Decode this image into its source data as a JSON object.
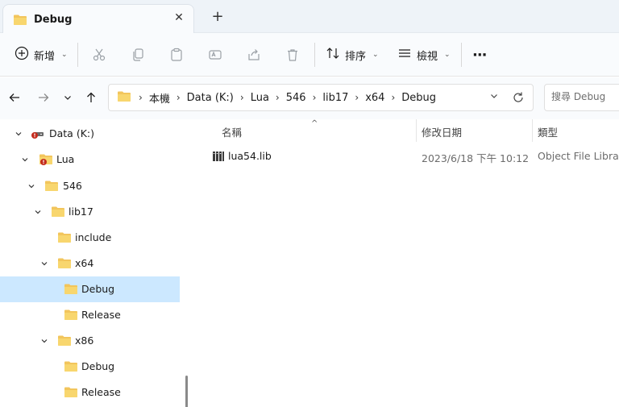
{
  "window": {
    "tab_title": "Debug",
    "close_glyph": "✕",
    "new_tab_glyph": "+"
  },
  "toolbar": {
    "new_label": "新增",
    "sort_label": "排序",
    "view_label": "檢視",
    "more_glyph": "···"
  },
  "address": {
    "crumbs": [
      "本機",
      "Data (K:)",
      "Lua",
      "546",
      "lib17",
      "x64",
      "Debug"
    ],
    "search_placeholder": "搜尋 Debug"
  },
  "nav_tree": [
    {
      "label": "Data (K:)",
      "expanded": true,
      "icon": "drive-warning-icon"
    },
    {
      "label": "Lua",
      "expanded": true,
      "icon": "folder-warning-icon"
    },
    {
      "label": "546",
      "expanded": true,
      "icon": "folder-icon"
    },
    {
      "label": "lib17",
      "expanded": true,
      "icon": "folder-icon"
    },
    {
      "label": "include",
      "expanded": null,
      "icon": "folder-icon"
    },
    {
      "label": "x64",
      "expanded": true,
      "icon": "folder-icon"
    },
    {
      "label": "Debug",
      "expanded": null,
      "icon": "folder-icon",
      "selected": true
    },
    {
      "label": "Release",
      "expanded": null,
      "icon": "folder-icon"
    },
    {
      "label": "x86",
      "expanded": true,
      "icon": "folder-icon"
    },
    {
      "label": "Debug",
      "expanded": null,
      "icon": "folder-icon"
    },
    {
      "label": "Release",
      "expanded": null,
      "icon": "folder-icon"
    }
  ],
  "columns": {
    "name": "名稱",
    "modified": "修改日期",
    "type": "類型"
  },
  "files": [
    {
      "name": "lua54.lib",
      "modified": "2023/6/18 下午 10:12",
      "type": "Object File Library"
    }
  ],
  "colors": {
    "accent": "#0067c0",
    "folder": "#f2c55c",
    "selected_bg": "#cce8ff",
    "warning": "#c42b1c"
  }
}
